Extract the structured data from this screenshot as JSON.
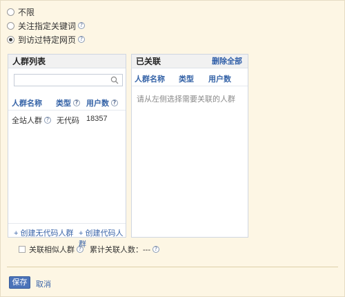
{
  "targeting": {
    "options": [
      {
        "label": "不限",
        "checked": false
      },
      {
        "label": "关注指定关键词",
        "checked": false,
        "help": "?"
      },
      {
        "label": "到访过特定网页",
        "checked": true,
        "help": "?"
      }
    ]
  },
  "left_panel": {
    "title": "人群列表",
    "search": {
      "placeholder": ""
    },
    "columns": {
      "name": "人群名称",
      "type": "类型",
      "users": "用户数"
    },
    "rows": [
      {
        "name": "全站人群",
        "type": "无代码",
        "users": "18357"
      }
    ],
    "create_no_code": "+ 创建无代码人群",
    "create_code": "+ 创建代码人群"
  },
  "right_panel": {
    "title": "已关联",
    "delete_all": "删除全部",
    "columns": {
      "name": "人群名称",
      "type": "类型",
      "users": "用户数"
    },
    "empty_hint": "请从左侧选择需要关联的人群"
  },
  "bottom": {
    "similar_label": "关联相似人群",
    "total_label": "累计关联人数：",
    "total_value": "---"
  },
  "actions": {
    "save": "保存",
    "cancel": "取消"
  },
  "colors": {
    "accent": "#4a73b9",
    "link": "#3a64a8",
    "background": "#fdf6e4"
  }
}
